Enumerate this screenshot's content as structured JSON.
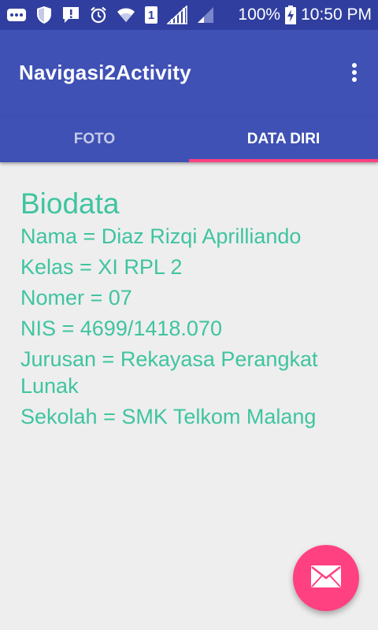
{
  "status_bar": {
    "battery_text": "100%",
    "time": "10:50 PM",
    "sim_slot": "1",
    "icons": [
      "more-icon",
      "shield-icon",
      "alert-icon",
      "alarm-icon",
      "wifi-icon",
      "sim-icon",
      "signal-icon",
      "signal-weak-icon",
      "battery-charging-icon"
    ]
  },
  "app_bar": {
    "title": "Navigasi2Activity",
    "overflow_icon": "more-vert-icon"
  },
  "tabs": [
    {
      "label": "FOTO",
      "active": false
    },
    {
      "label": "DATA DIRI",
      "active": true
    }
  ],
  "biodata": {
    "title": "Biodata",
    "lines": [
      "Nama = Diaz Rizqi Aprilliando",
      "Kelas = XI RPL 2",
      "Nomer = 07",
      "NIS = 4699/1418.070",
      "Jurusan = Rekayasa Perangkat Lunak",
      "Sekolah = SMK Telkom Malang"
    ]
  },
  "fab": {
    "icon": "mail-icon"
  },
  "colors": {
    "status_bar": "#303f9f",
    "primary": "#3f51b5",
    "accent": "#ff4081",
    "text_teal": "#3fc4a0",
    "background": "#eeeeee"
  }
}
